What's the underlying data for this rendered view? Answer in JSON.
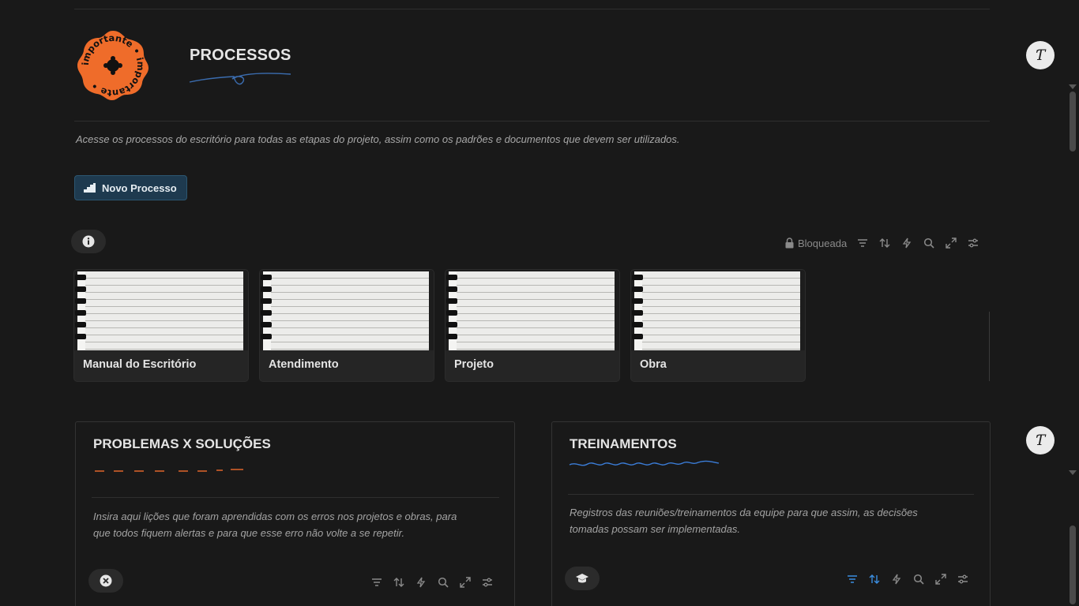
{
  "sticker": {
    "text": "importante • importante • ",
    "color": "#ef6c2a"
  },
  "header": {
    "title": "PROCESSOS"
  },
  "description": "Acesse os processos do escritório para todas as etapas do projeto, assim como os padrões e documentos que devem ser utilizados.",
  "new_button": {
    "label": "Novo Processo",
    "icon": "stairs-icon"
  },
  "toolbar": {
    "lock_label": "Bloqueada",
    "icons": [
      "filter-icon",
      "sort-icon",
      "automation-icon",
      "search-icon",
      "expand-icon",
      "settings-icon"
    ]
  },
  "gallery": {
    "cards": [
      {
        "title": "Manual do Escritório"
      },
      {
        "title": "Atendimento"
      },
      {
        "title": "Projeto"
      },
      {
        "title": "Obra"
      }
    ]
  },
  "panels": {
    "problems": {
      "title": "PROBLEMAS X SOLUÇÕES",
      "text_line1": "Insira aqui lições que foram aprendidas com os erros nos projetos e obras, para",
      "text_line2": "que todos fiquem alertas e para que esse erro não volte a se repetir.",
      "accent": "#e0652a"
    },
    "trainings": {
      "title": "TREINAMENTOS",
      "text_line1": "Registros das reuniões/treinamentos da equipe para que assim, as decisões",
      "text_line2": "tomadas possam ser implementadas.",
      "accent": "#3b7dd8"
    }
  },
  "avatar": {
    "glyph": "Ƭ"
  }
}
